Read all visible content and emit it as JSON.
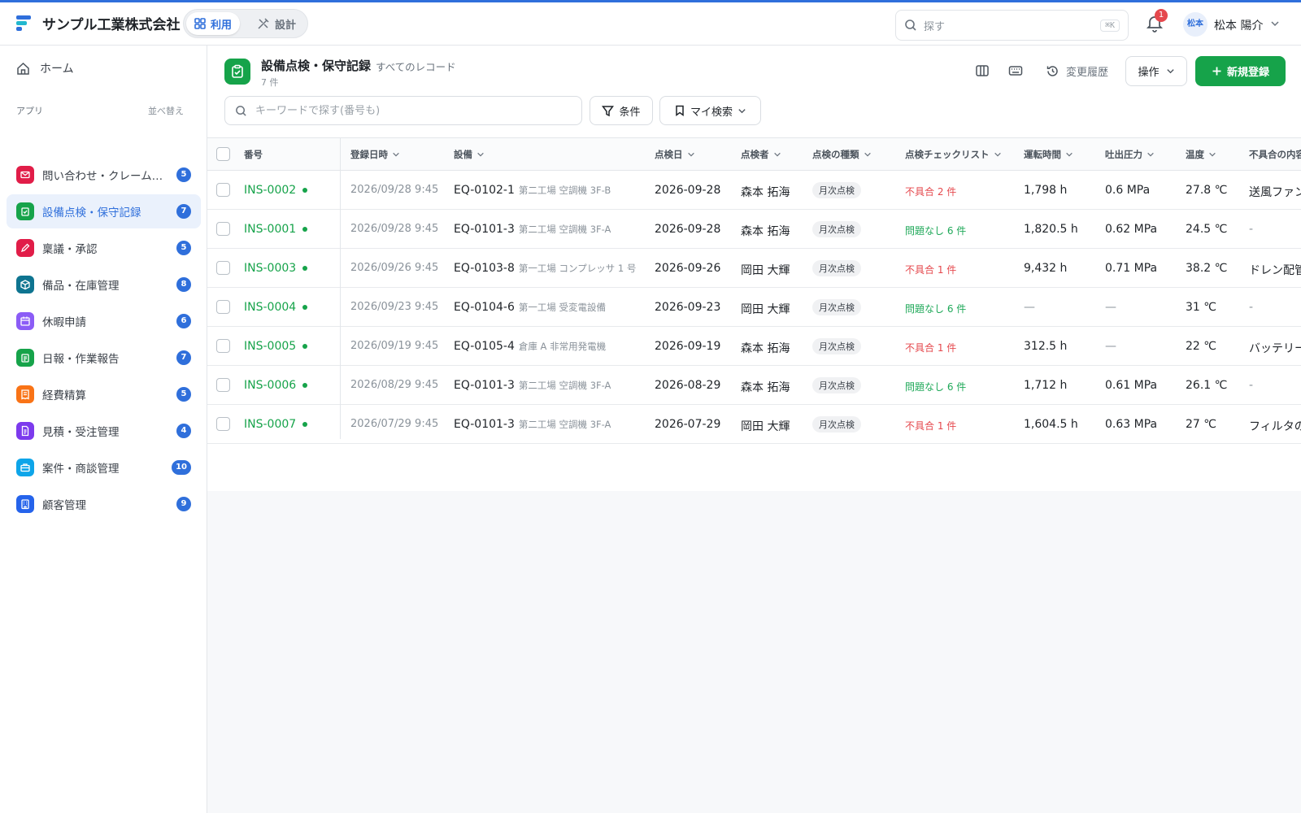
{
  "header": {
    "company": "サンプル工業株式会社",
    "mode_use": "利用",
    "mode_design": "設計",
    "search_placeholder": "探す",
    "search_shortcut": "⌘K",
    "notifications": "1",
    "avatar": "松本",
    "user_name": "松本 陽介",
    "accent_color": "#2f6fdb"
  },
  "sidebar": {
    "home": "ホーム",
    "apps_label": "アプリ",
    "sort_label": "並べ替え",
    "items": [
      {
        "label": "問い合わせ・クレーム管...",
        "count": "5",
        "color": "#e11d48",
        "icon": "mail-icon"
      },
      {
        "label": "設備点検・保守記録",
        "count": "7",
        "color": "#16a34a",
        "icon": "clipboard-check-icon"
      },
      {
        "label": "稟議・承認",
        "count": "5",
        "color": "#e11d48",
        "icon": "pen-icon"
      },
      {
        "label": "備品・在庫管理",
        "count": "8",
        "color": "#0e7490",
        "icon": "box-icon"
      },
      {
        "label": "休暇申請",
        "count": "6",
        "color": "#8b5cf6",
        "icon": "calendar-icon"
      },
      {
        "label": "日報・作業報告",
        "count": "7",
        "color": "#16a34a",
        "icon": "clipboard-icon"
      },
      {
        "label": "経費精算",
        "count": "5",
        "color": "#f97316",
        "icon": "receipt-icon"
      },
      {
        "label": "見積・受注管理",
        "count": "4",
        "color": "#7c3aed",
        "icon": "document-icon"
      },
      {
        "label": "案件・商談管理",
        "count": "10",
        "color": "#0ea5e9",
        "icon": "briefcase-icon"
      },
      {
        "label": "顧客管理",
        "count": "9",
        "color": "#2563eb",
        "icon": "building-icon"
      }
    ]
  },
  "page": {
    "title": "設備点検・保守記録",
    "subtitle": "すべてのレコード",
    "count": "7 件",
    "history": "変更履歴",
    "ops": "操作",
    "new": "新規登録",
    "keyword_placeholder": "キーワードで探す(番号も)",
    "conditions": "条件",
    "my_search": "マイ検索"
  },
  "table": {
    "columns": [
      "番号",
      "登録日時",
      "設備",
      "点検日",
      "点検者",
      "点検の種類",
      "点検チェックリスト",
      "運転時間",
      "吐出圧力",
      "温度",
      "不具合の内容"
    ],
    "rows": [
      {
        "num": "INS-0002",
        "reg": "2026/09/28 9:45",
        "eq": "EQ-0102-1",
        "loc": "第二工場 空調機 3F-B",
        "date": "2026-09-28",
        "inspector": "森本 拓海",
        "kind": "月次点検",
        "check": "不具合 2 件",
        "status": "ng",
        "hours": "1,798 h",
        "pressure": "0.6 MPa",
        "temp": "27.8 ℃",
        "defect": "送風ファン"
      },
      {
        "num": "INS-0001",
        "reg": "2026/09/28 9:45",
        "eq": "EQ-0101-3",
        "loc": "第二工場 空調機 3F-A",
        "date": "2026-09-28",
        "inspector": "森本 拓海",
        "kind": "月次点検",
        "check": "問題なし 6 件",
        "status": "ok",
        "hours": "1,820.5 h",
        "pressure": "0.62 MPa",
        "temp": "24.5 ℃",
        "defect": "-"
      },
      {
        "num": "INS-0003",
        "reg": "2026/09/26 9:45",
        "eq": "EQ-0103-8",
        "loc": "第一工場 コンプレッサ 1 号",
        "date": "2026-09-26",
        "inspector": "岡田 大輝",
        "kind": "月次点検",
        "check": "不具合 1 件",
        "status": "ng",
        "hours": "9,432 h",
        "pressure": "0.71 MPa",
        "temp": "38.2 ℃",
        "defect": "ドレン配管"
      },
      {
        "num": "INS-0004",
        "reg": "2026/09/23 9:45",
        "eq": "EQ-0104-6",
        "loc": "第一工場 受変電設備",
        "date": "2026-09-23",
        "inspector": "岡田 大輝",
        "kind": "月次点検",
        "check": "問題なし 6 件",
        "status": "ok",
        "hours": "—",
        "pressure": "—",
        "temp": "31 ℃",
        "defect": "-"
      },
      {
        "num": "INS-0005",
        "reg": "2026/09/19 9:45",
        "eq": "EQ-0105-4",
        "loc": "倉庫 A 非常用発電機",
        "date": "2026-09-19",
        "inspector": "森本 拓海",
        "kind": "月次点検",
        "check": "不具合 1 件",
        "status": "ng",
        "hours": "312.5 h",
        "pressure": "—",
        "temp": "22 ℃",
        "defect": "バッテリー"
      },
      {
        "num": "INS-0006",
        "reg": "2026/08/29 9:45",
        "eq": "EQ-0101-3",
        "loc": "第二工場 空調機 3F-A",
        "date": "2026-08-29",
        "inspector": "森本 拓海",
        "kind": "月次点検",
        "check": "問題なし 6 件",
        "status": "ok",
        "hours": "1,712 h",
        "pressure": "0.61 MPa",
        "temp": "26.1 ℃",
        "defect": "-"
      },
      {
        "num": "INS-0007",
        "reg": "2026/07/29 9:45",
        "eq": "EQ-0101-3",
        "loc": "第二工場 空調機 3F-A",
        "date": "2026-07-29",
        "inspector": "岡田 大輝",
        "kind": "月次点検",
        "check": "不具合 1 件",
        "status": "ng",
        "hours": "1,604.5 h",
        "pressure": "0.63 MPa",
        "temp": "27 ℃",
        "defect": "フィルタの目"
      }
    ]
  }
}
